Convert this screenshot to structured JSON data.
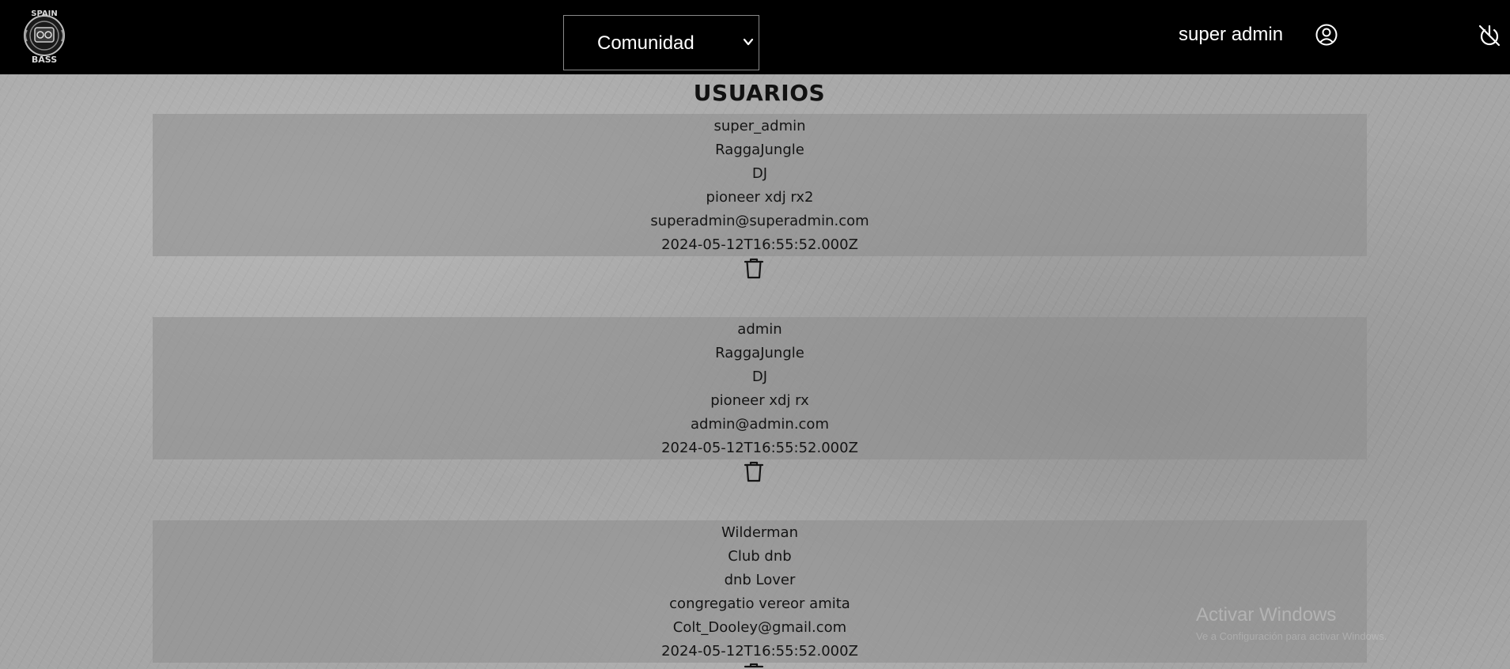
{
  "header": {
    "logo_text_top": "SPAIN",
    "logo_text_bottom": "BASS",
    "section_select": {
      "selected": "Comunidad",
      "options": [
        "Comunidad"
      ]
    },
    "user_name": "super admin",
    "icons": {
      "profile": "user-circle-icon",
      "logout": "power-off-icon",
      "dropdown": "chevron-down-icon",
      "delete": "trash-icon"
    }
  },
  "main": {
    "title": "USUARIOS",
    "users": [
      {
        "username": "super_admin",
        "genre": "RaggaJungle",
        "role": "DJ",
        "equipment": "pioneer xdj rx2",
        "email": "superadmin@superadmin.com",
        "created_at": "2024-05-12T16:55:52.000Z"
      },
      {
        "username": "admin",
        "genre": "RaggaJungle",
        "role": "DJ",
        "equipment": "pioneer xdj rx",
        "email": "admin@admin.com",
        "created_at": "2024-05-12T16:55:52.000Z"
      },
      {
        "username": "Wilderman",
        "genre": "Club dnb",
        "role": "dnb Lover",
        "equipment": "congregatio vereor amita",
        "email": "Colt_Dooley@gmail.com",
        "created_at": "2024-05-12T16:55:52.000Z"
      }
    ]
  },
  "os_watermark": {
    "title": "Activar Windows",
    "subtitle": "Ve a Configuración para activar Windows."
  },
  "colors": {
    "header_bg": "#000000",
    "header_text": "#ffffff",
    "card_bg": "rgba(140,140,140,0.55)",
    "body_text": "#141414"
  }
}
